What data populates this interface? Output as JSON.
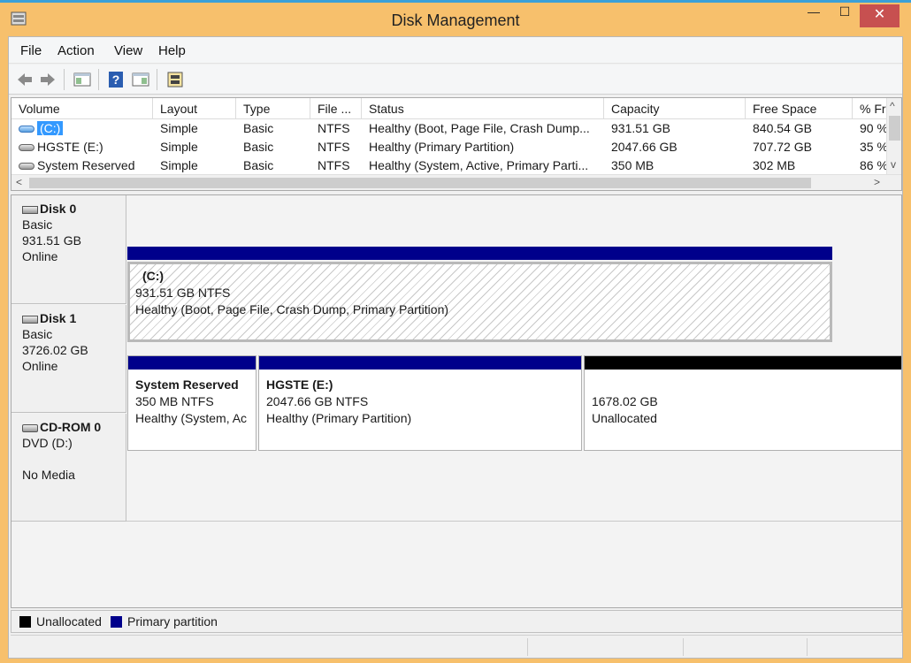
{
  "window": {
    "title": "Disk Management",
    "close_glyph": "✕",
    "max_glyph": "☐",
    "min_glyph": "—"
  },
  "menu": [
    "File",
    "Action",
    "View",
    "Help"
  ],
  "toolbar": {
    "icons": [
      "back-arrow-icon",
      "forward-arrow-icon",
      "console-tree-icon",
      "help-icon",
      "properties-icon",
      "disk-tool-icon"
    ]
  },
  "volume_list": {
    "columns": [
      "Volume",
      "Layout",
      "Type",
      "File ...",
      "Status",
      "Capacity",
      "Free Space",
      "% Fr"
    ],
    "rows": [
      [
        "(C:)",
        "Simple",
        "Basic",
        "NTFS",
        "Healthy (Boot, Page File, Crash Dump...",
        "931.51 GB",
        "840.54 GB",
        "90 %"
      ],
      [
        "HGSTE (E:)",
        "Simple",
        "Basic",
        "NTFS",
        "Healthy (Primary Partition)",
        "2047.66 GB",
        "707.72 GB",
        "35 %"
      ],
      [
        "System Reserved",
        "Simple",
        "Basic",
        "NTFS",
        "Healthy (System, Active, Primary Parti...",
        "350 MB",
        "302 MB",
        "86 %"
      ]
    ],
    "scroll_left": "<",
    "scroll_right": ">",
    "scroll_up": "^",
    "scroll_down": "v"
  },
  "disks": [
    {
      "name": "Disk 0",
      "type": "Basic",
      "size": "931.51 GB",
      "state": "Online",
      "partitions": [
        {
          "name": "(C:)",
          "size": "931.51 GB NTFS",
          "status": "Healthy (Boot, Page File, Crash Dump, Primary Partition)",
          "kind": "primary"
        }
      ]
    },
    {
      "name": "Disk 1",
      "type": "Basic",
      "size": "3726.02 GB",
      "state": "Online",
      "partitions": [
        {
          "name": "System Reserved",
          "size": "350 MB NTFS",
          "status": "Healthy (System, Ac",
          "kind": "primary"
        },
        {
          "name": "HGSTE  (E:)",
          "size": "2047.66 GB NTFS",
          "status": "Healthy (Primary Partition)",
          "kind": "primary"
        },
        {
          "name": "",
          "size": "1678.02 GB",
          "status": "Unallocated",
          "kind": "unallocated"
        }
      ]
    },
    {
      "name": "CD-ROM 0",
      "type": "DVD (D:)",
      "size": "",
      "state": "No Media",
      "partitions": []
    }
  ],
  "legend": [
    {
      "label": "Unallocated",
      "color": "#000000"
    },
    {
      "label": "Primary partition",
      "color": "#00008b"
    }
  ]
}
